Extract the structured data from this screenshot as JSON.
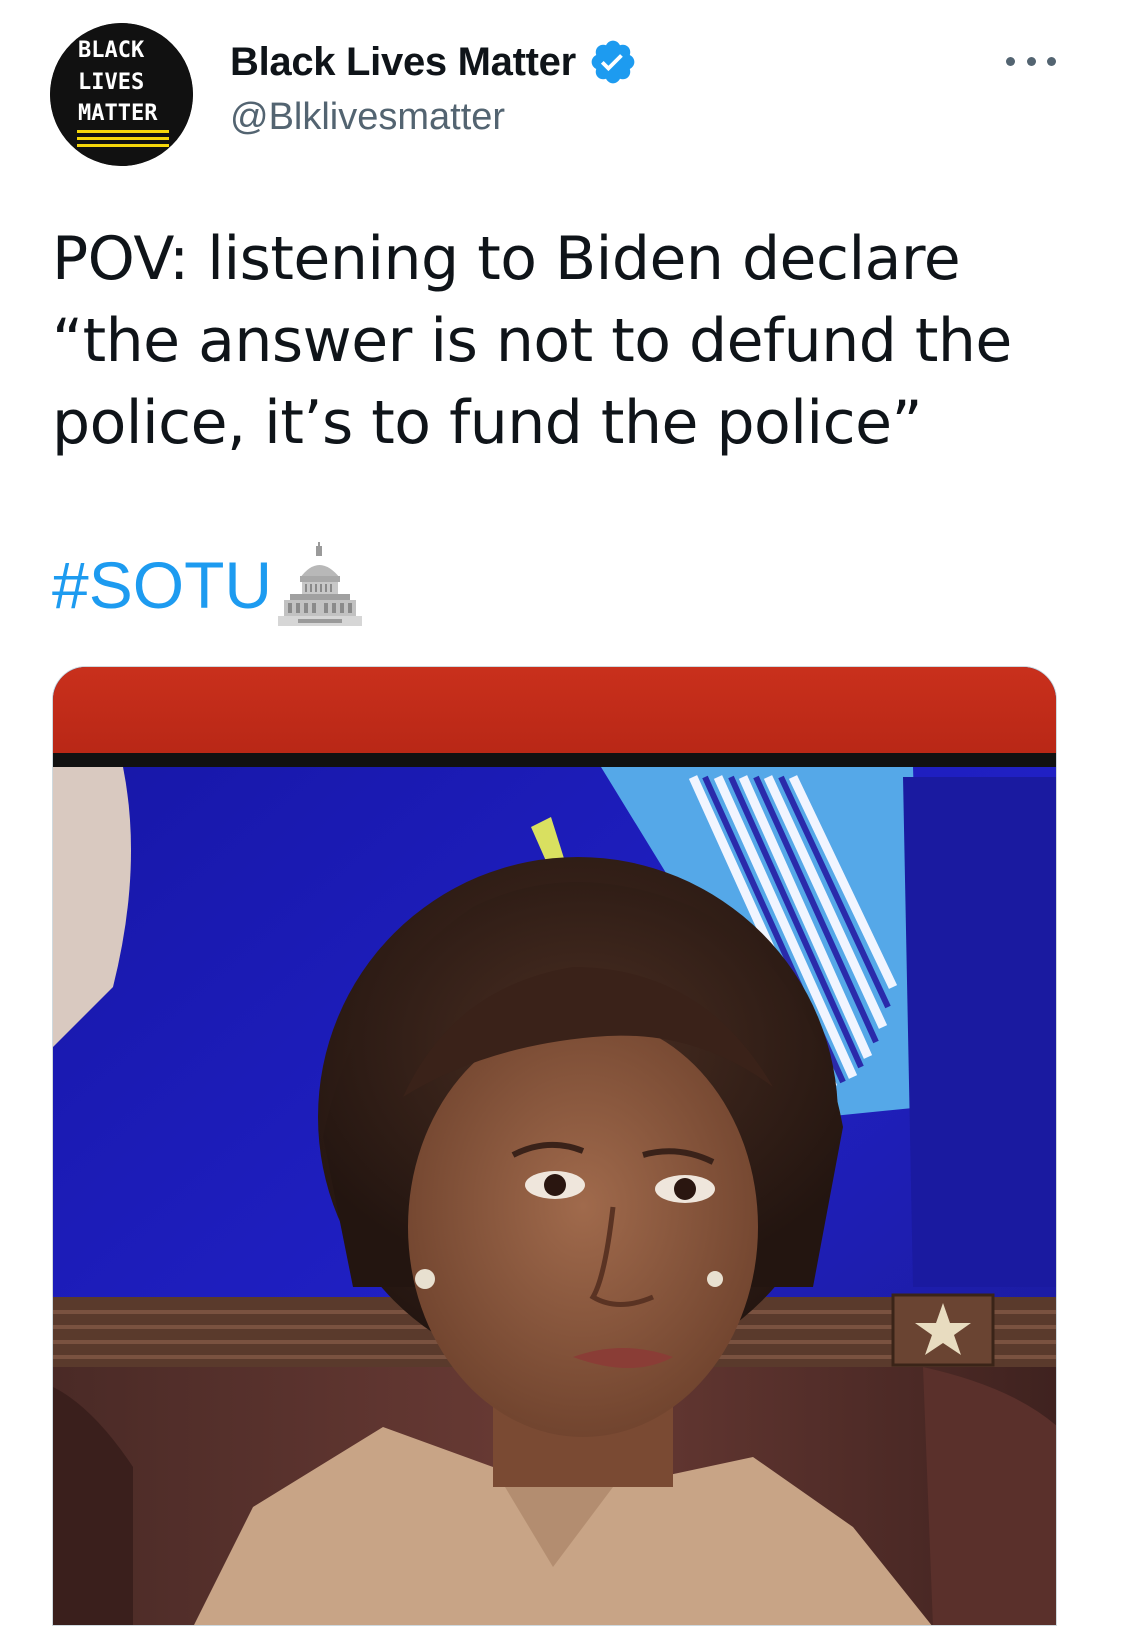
{
  "account": {
    "display_name": "Black Lives Matter",
    "handle": "@Blklivesmatter",
    "avatar_text": [
      "BLACK",
      "LIVES",
      "MATTER"
    ],
    "verified": true
  },
  "tweet": {
    "text": "POV: listening to Biden declare\n“the answer is not to defund the\npolice, it’s to fund the police”",
    "hashtag": "#SOTU",
    "hashtag_emoji": "capitol-building"
  },
  "media": {
    "kind": "photo",
    "description_icon": "photo"
  },
  "icons": {
    "verified": "verified-badge-icon",
    "more": "more-options-icon",
    "hashtag_emoji": "capitol-icon"
  },
  "colors": {
    "link": "#1d9bf0",
    "handle": "#536471",
    "verified": "#1d9bf0",
    "text": "#0f1419"
  }
}
